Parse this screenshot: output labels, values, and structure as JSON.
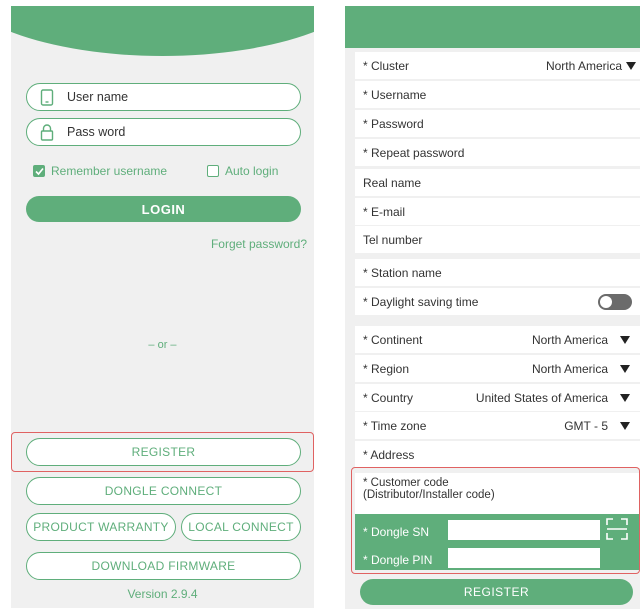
{
  "login": {
    "username_placeholder": "User name",
    "password_placeholder": "Pass word",
    "remember_label": "Remember username",
    "remember_checked": true,
    "auto_login_label": "Auto login",
    "auto_login_checked": false,
    "login_button": "LOGIN",
    "forget_link": "Forget password?",
    "or_text": "– or –",
    "register_button": "REGISTER",
    "dongle_connect_button": "DONGLE CONNECT",
    "product_warranty_button": "PRODUCT WARRANTY",
    "local_connect_button": "LOCAL CONNECT",
    "download_firmware_button": "DOWNLOAD FIRMWARE",
    "version": "Version 2.9.4"
  },
  "register": {
    "cluster_label": "* Cluster",
    "cluster_value": "North America",
    "username_label": "* Username",
    "password_label": "* Password",
    "repeat_password_label": "* Repeat password",
    "real_name_label": "Real name",
    "email_label": "* E-mail",
    "tel_label": "Tel number",
    "station_name_label": "* Station name",
    "daylight_label": "* Daylight saving time",
    "daylight_on": false,
    "continent_label": "* Continent",
    "continent_value": "North America",
    "region_label": "* Region",
    "region_value": "North America",
    "country_label": "* Country",
    "country_value": "United States of America",
    "timezone_label": "* Time zone",
    "timezone_value": "GMT - 5",
    "address_label": "* Address",
    "customer_code_label": "* Customer code",
    "customer_code_sub": "(Distributor/Installer code)",
    "dongle_sn_label": "* Dongle SN",
    "dongle_pin_label": "* Dongle PIN",
    "register_button": "REGISTER"
  },
  "colors": {
    "accent": "#5fae7b",
    "highlight": "#e06262",
    "background": "#f0f0f0"
  }
}
